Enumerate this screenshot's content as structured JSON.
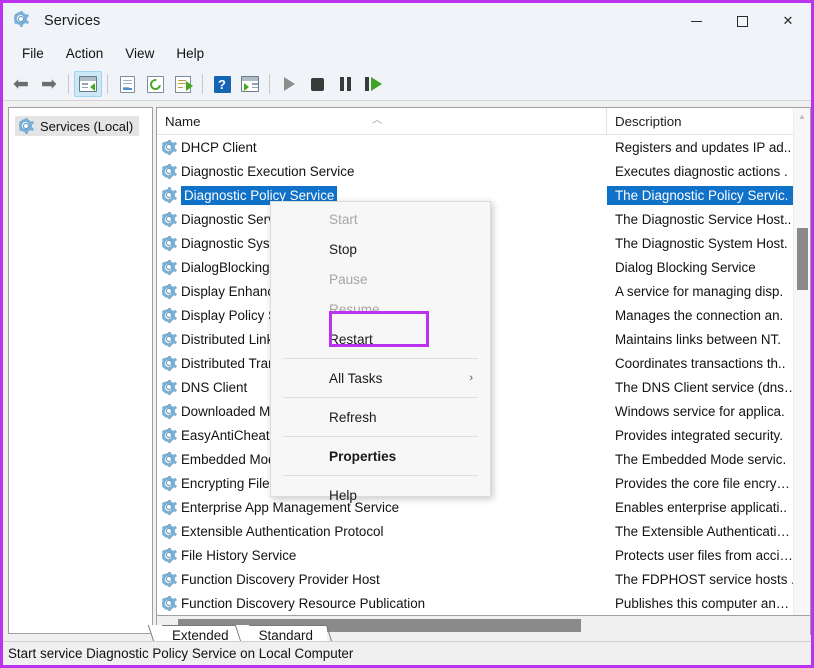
{
  "window": {
    "title": "Services",
    "title_icon": "gear-icon",
    "controls": {
      "minimize": "minimize-icon",
      "maximize": "maximize-icon",
      "close": "close-icon"
    }
  },
  "menubar": {
    "items": [
      "File",
      "Action",
      "View",
      "Help"
    ]
  },
  "toolbar": {
    "buttons": [
      "back-arrow-icon",
      "forward-arrow-icon",
      "show-hide-console-tree-icon",
      "properties-window-icon",
      "refresh-icon",
      "export-list-icon",
      "help-icon",
      "show-hide-action-pane-icon",
      "start-service-icon",
      "stop-service-icon",
      "pause-service-icon",
      "restart-service-icon"
    ]
  },
  "sidebar": {
    "items": [
      {
        "label": "Services (Local)",
        "icon": "gear-icon",
        "selected": true
      }
    ]
  },
  "list": {
    "columns": [
      {
        "label": "Name",
        "sort": "ascending"
      },
      {
        "label": "Description"
      }
    ],
    "rows": [
      {
        "name": "DHCP Client",
        "description": "Registers and updates IP ad..",
        "selected": false
      },
      {
        "name": "Diagnostic Execution Service",
        "description": "Executes diagnostic actions .",
        "selected": false
      },
      {
        "name": "Diagnostic Policy Service",
        "description": "The Diagnostic Policy Servic.",
        "selected": true
      },
      {
        "name": "Diagnostic Service Host",
        "description": "The Diagnostic Service Host..",
        "selected": false
      },
      {
        "name": "Diagnostic System Host",
        "description": "The Diagnostic System Host.",
        "selected": false
      },
      {
        "name": "DialogBlockingService",
        "description": "Dialog Blocking Service",
        "selected": false
      },
      {
        "name": "Display Enhancement Service",
        "description": "A service for managing disp.",
        "selected": false
      },
      {
        "name": "Display Policy Service",
        "description": "Manages the connection an.",
        "selected": false
      },
      {
        "name": "Distributed Link Tracking Client",
        "description": "Maintains links between NT.",
        "selected": false
      },
      {
        "name": "Distributed Transaction Coordinator",
        "description": "Coordinates transactions th..",
        "selected": false
      },
      {
        "name": "DNS Client",
        "description": "The DNS Client service (dns…",
        "selected": false
      },
      {
        "name": "Downloaded Maps Manager",
        "description": "Windows service for applica.",
        "selected": false
      },
      {
        "name": "EasyAntiCheat",
        "description": "Provides integrated security.",
        "selected": false
      },
      {
        "name": "Embedded Mode",
        "description": "The Embedded Mode servic.",
        "selected": false
      },
      {
        "name": "Encrypting File System (EFS)",
        "description": "Provides the core file encry…",
        "selected": false
      },
      {
        "name": "Enterprise App Management Service",
        "description": "Enables enterprise applicati..",
        "selected": false
      },
      {
        "name": "Extensible Authentication Protocol",
        "description": "The Extensible Authenticati…",
        "selected": false
      },
      {
        "name": "File History Service",
        "description": "Protects user files from acci…",
        "selected": false
      },
      {
        "name": "Function Discovery Provider Host",
        "description": "The FDPHOST service hosts ..",
        "selected": false
      },
      {
        "name": "Function Discovery Resource Publication",
        "description": "Publishes this computer an…",
        "selected": false
      }
    ]
  },
  "context_menu": {
    "items": [
      {
        "label": "Start",
        "disabled": true,
        "type": "item"
      },
      {
        "label": "Stop",
        "disabled": false,
        "type": "item"
      },
      {
        "label": "Pause",
        "disabled": true,
        "type": "item"
      },
      {
        "label": "Resume",
        "disabled": true,
        "type": "item"
      },
      {
        "label": "Restart",
        "disabled": false,
        "type": "item",
        "highlighted": true
      },
      {
        "type": "separator"
      },
      {
        "label": "All Tasks",
        "disabled": false,
        "type": "item",
        "submenu": "›"
      },
      {
        "type": "separator"
      },
      {
        "label": "Refresh",
        "disabled": false,
        "type": "item"
      },
      {
        "type": "separator"
      },
      {
        "label": "Properties",
        "disabled": false,
        "type": "item",
        "bold": true
      },
      {
        "type": "separator"
      },
      {
        "label": "Help",
        "disabled": false,
        "type": "item"
      }
    ],
    "highlight_color": "#bb33ee"
  },
  "tabs": {
    "items": [
      {
        "label": "Extended",
        "active": false
      },
      {
        "label": "Standard",
        "active": true
      }
    ]
  },
  "statusbar": {
    "text": "Start service Diagnostic Policy Service on Local Computer"
  },
  "colors": {
    "selection": "#0f71c8",
    "annotation": "#bb33ee",
    "chrome": "#f0f3f7",
    "scrollbar_thumb": "#8a8a8a"
  }
}
